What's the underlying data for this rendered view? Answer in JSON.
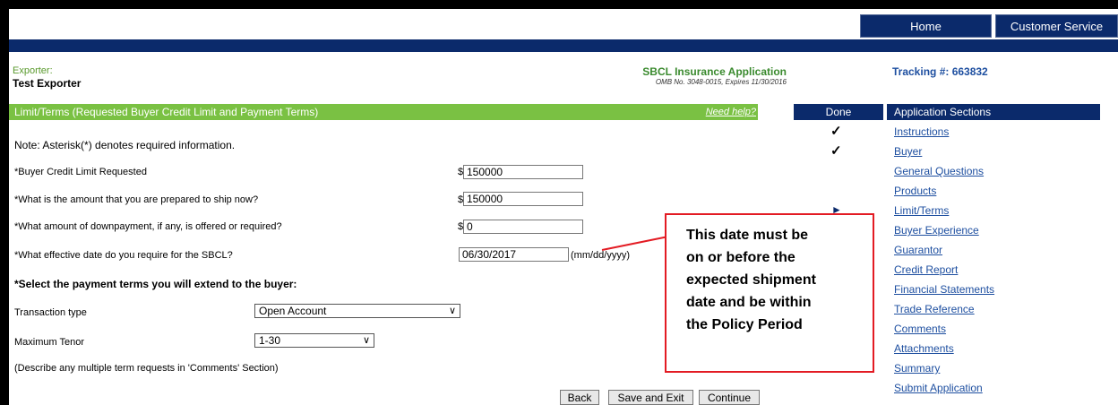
{
  "topnav": {
    "home": "Home",
    "customer_service": "Customer Service"
  },
  "header": {
    "exporter_label": "Exporter:",
    "exporter_name": "Test Exporter",
    "app_title": "SBCL Insurance Application",
    "omb": "OMB No. 3048-0015,  Expires 11/30/2016",
    "tracking": "Tracking #: 663832"
  },
  "section": {
    "title": "Limit/Terms (Requested Buyer Credit Limit and Payment Terms)",
    "help": "Need help?"
  },
  "form": {
    "note": "Note: Asterisk(*) denotes required information.",
    "credit_limit": {
      "label": "*Buyer Credit Limit Requested",
      "currency": "$",
      "value": "150000"
    },
    "ship_now": {
      "label": "*What is the amount that you are prepared to ship now?",
      "currency": "$",
      "value": "150000"
    },
    "downpayment": {
      "label": "*What amount of downpayment, if any, is offered or required?",
      "currency": "$",
      "value": "0"
    },
    "effective_date": {
      "label": "*What effective date do you require for the SBCL?",
      "value": "06/30/2017",
      "hint": "(mm/dd/yyyy)"
    },
    "payment_heading": "*Select the payment terms you will extend to the buyer:",
    "transaction_type": {
      "label": "Transaction type",
      "selected": "Open Account"
    },
    "max_tenor": {
      "label": "Maximum Tenor",
      "selected": "1-30"
    },
    "multi_note": "(Describe any multiple term requests in 'Comments' Section)"
  },
  "buttons": {
    "back": "Back",
    "save_exit": "Save and Exit",
    "continue": "Continue"
  },
  "sidebar": {
    "done_header": "Done",
    "sections_header": "Application Sections",
    "items": [
      {
        "label": "Instructions",
        "done": true
      },
      {
        "label": "Buyer",
        "done": true
      },
      {
        "label": "General Questions",
        "done": false
      },
      {
        "label": "Products",
        "done": false
      },
      {
        "label": "Limit/Terms",
        "current": true
      },
      {
        "label": "Buyer Experience",
        "done": false
      },
      {
        "label": "Guarantor",
        "done": false
      },
      {
        "label": "Credit Report",
        "done": false
      },
      {
        "label": "Financial Statements",
        "done": false
      },
      {
        "label": "Trade Reference",
        "done": false
      },
      {
        "label": "Comments",
        "done": false
      },
      {
        "label": "Attachments",
        "done": false
      },
      {
        "label": "Summary",
        "done": false
      },
      {
        "label": "Submit Application",
        "done": false
      }
    ],
    "check_glyph": "✓",
    "current_glyph": "►"
  },
  "callout": {
    "lines": [
      "This date must be",
      "on or before the",
      "expected shipment",
      "date and be within",
      "the Policy Period"
    ]
  },
  "colors": {
    "navy": "#0b2a6b",
    "green_bar": "#7ac143",
    "link": "#1e4fa0",
    "callout_border": "#e31b23"
  }
}
